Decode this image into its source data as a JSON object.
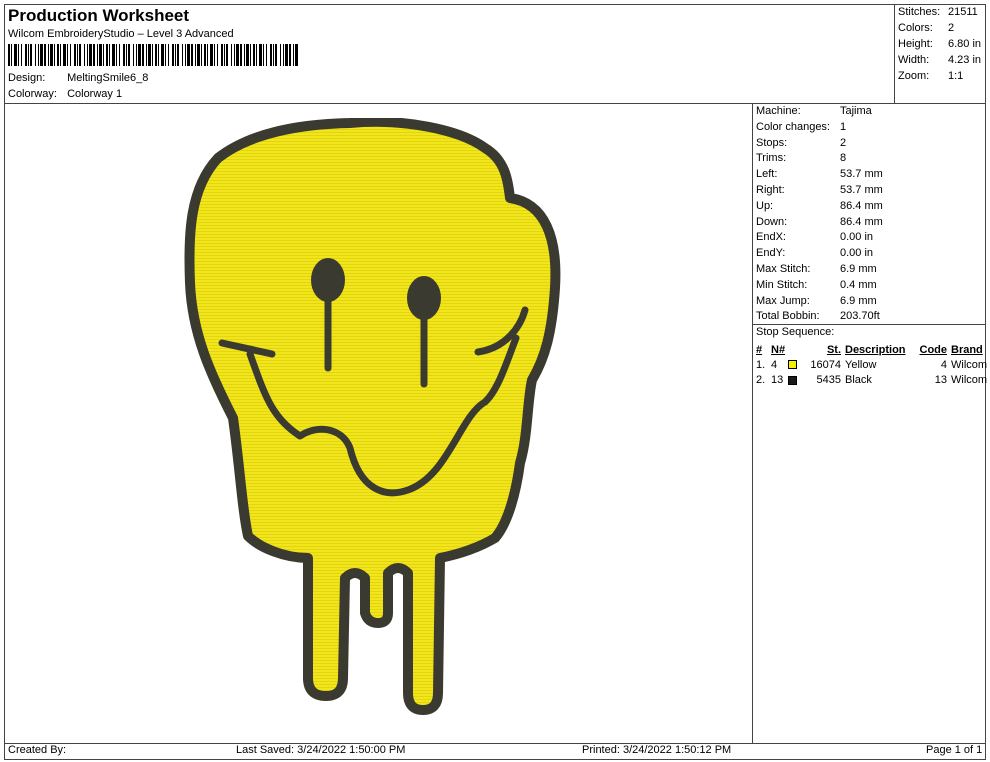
{
  "header": {
    "title": "Production Worksheet",
    "subtitle": "Wilcom EmbroideryStudio – Level 3 Advanced",
    "design_label": "Design:",
    "design_value": "MeltingSmile6_8",
    "colorway_label": "Colorway:",
    "colorway_value": "Colorway 1"
  },
  "summary": {
    "stitches_label": "Stitches:",
    "stitches_value": "21511",
    "colors_label": "Colors:",
    "colors_value": "2",
    "height_label": "Height:",
    "height_value": "6.80 in",
    "width_label": "Width:",
    "width_value": "4.23 in",
    "zoom_label": "Zoom:",
    "zoom_value": "1:1"
  },
  "details": [
    {
      "label": "Machine:",
      "value": "Tajima"
    },
    {
      "label": "Color changes:",
      "value": "1"
    },
    {
      "label": "Stops:",
      "value": "2"
    },
    {
      "label": "Trims:",
      "value": "8"
    },
    {
      "label": "Left:",
      "value": "53.7 mm"
    },
    {
      "label": "Right:",
      "value": "53.7 mm"
    },
    {
      "label": "Up:",
      "value": "86.4 mm"
    },
    {
      "label": "Down:",
      "value": "86.4 mm"
    },
    {
      "label": "EndX:",
      "value": "0.00 in"
    },
    {
      "label": "EndY:",
      "value": "0.00 in"
    },
    {
      "label": "Max Stitch:",
      "value": "6.9 mm"
    },
    {
      "label": "Min Stitch:",
      "value": "0.4 mm"
    },
    {
      "label": "Max Jump:",
      "value": "6.9 mm"
    },
    {
      "label": "Total Bobbin:",
      "value": "203.70ft"
    }
  ],
  "stop_sequence": {
    "title": "Stop Sequence:",
    "headers": {
      "num": "#",
      "n": "N#",
      "st": "St.",
      "description": "Description",
      "code": "Code",
      "brand": "Brand"
    },
    "rows": [
      {
        "num": "1.",
        "n": "4",
        "color": "#f5f000",
        "st": "16074",
        "description": "Yellow",
        "code": "4",
        "brand": "Wilcom"
      },
      {
        "num": "2.",
        "n": "13",
        "color": "#1a1a1a",
        "st": "5435",
        "description": "Black",
        "code": "13",
        "brand": "Wilcom"
      }
    ]
  },
  "footer": {
    "created_by": "Created By:",
    "last_saved": "Last Saved: 3/24/2022 1:50:00 PM",
    "printed": "Printed: 3/24/2022 1:50:12 PM",
    "page": "Page 1 of 1"
  },
  "colors": {
    "fill": "#f2e61a",
    "outline": "#3b3a30",
    "border": "#444444"
  }
}
